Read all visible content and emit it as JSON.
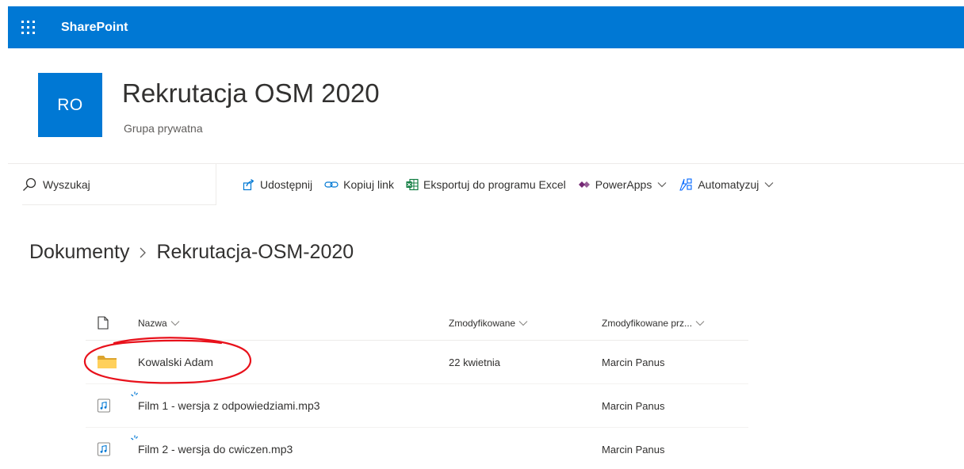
{
  "suitebar": {
    "brand": "SharePoint",
    "waffle_icon": "app-launcher-icon",
    "color": "#0078d4"
  },
  "site": {
    "logo_text": "RO",
    "title": "Rekrutacja OSM 2020",
    "subtitle": "Grupa prywatna"
  },
  "search": {
    "placeholder": "Wyszukaj"
  },
  "commands": {
    "share": "Udostępnij",
    "copy_link": "Kopiuj link",
    "export_excel": "Eksportuj do programu Excel",
    "powerapps": "PowerApps",
    "automate": "Automatyzuj"
  },
  "breadcrumb": {
    "items": [
      "Dokumenty",
      "Rekrutacja-OSM-2020"
    ]
  },
  "list": {
    "columns": {
      "name": "Nazwa",
      "modified": "Zmodyfikowane",
      "modified_by": "Zmodyfikowane prz..."
    },
    "rows": [
      {
        "type": "folder",
        "name": "Kowalski Adam",
        "modified": "22 kwietnia",
        "modified_by": "Marcin Panus"
      },
      {
        "type": "audio",
        "name": "Film 1 - wersja z odpowiedziami.mp3",
        "modified": "",
        "modified_by": "Marcin Panus"
      },
      {
        "type": "audio",
        "name": "Film 2 - wersja do cwiczen.mp3",
        "modified": "",
        "modified_by": "Marcin Panus"
      }
    ]
  },
  "annotation_color": "#e8111b"
}
